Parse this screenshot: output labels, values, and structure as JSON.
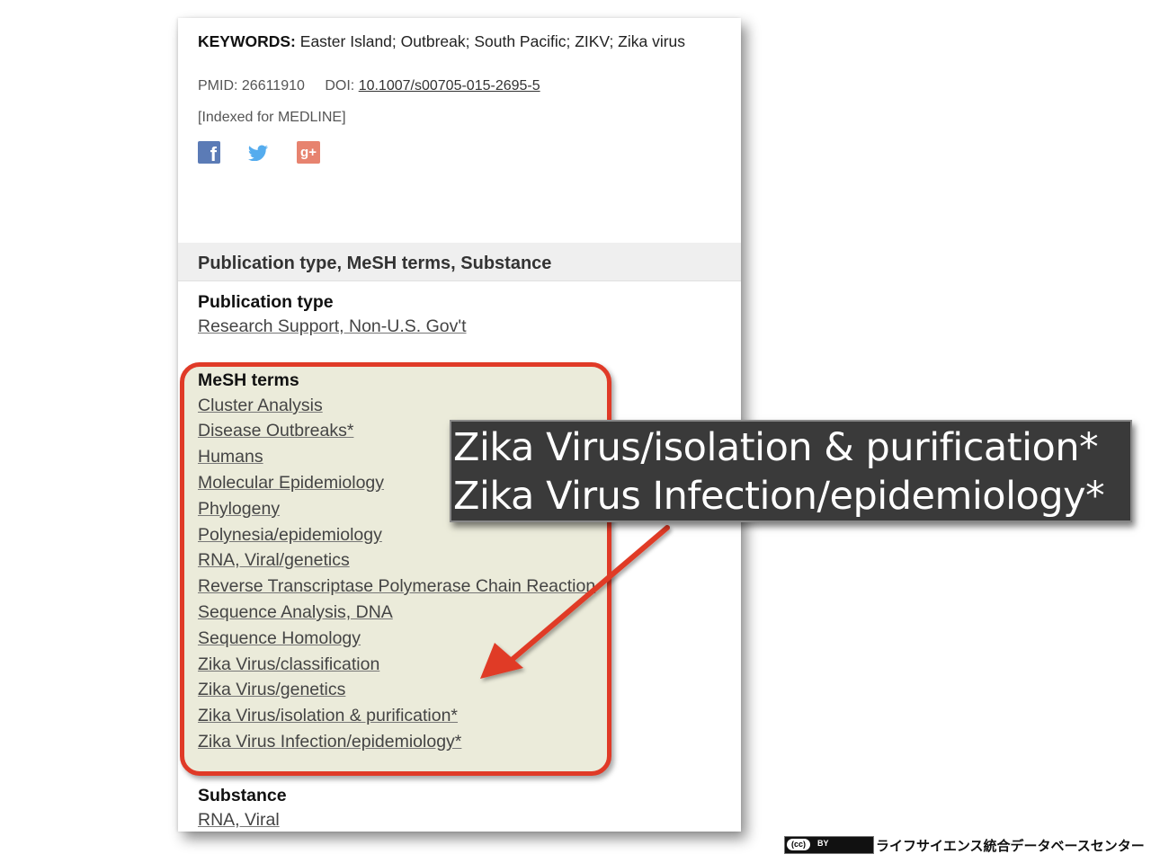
{
  "keywords": {
    "label": "KEYWORDS:",
    "value": "Easter Island; Outbreak; South Pacific; ZIKV; Zika virus"
  },
  "meta": {
    "pmid": "PMID: 26611910",
    "doi_label": "DOI:",
    "doi_link": "10.1007/s00705-015-2695-5",
    "indexed": "[Indexed for MEDLINE]"
  },
  "social": {
    "facebook_icon": "facebook-icon",
    "twitter_icon": "twitter-icon",
    "googleplus_icon": "google-plus-icon"
  },
  "section": {
    "title": "Publication type, MeSH terms, Substance"
  },
  "publication_type": {
    "heading": "Publication type",
    "items": [
      "Research Support, Non-U.S. Gov't"
    ]
  },
  "mesh": {
    "heading": "MeSH terms",
    "items": [
      "Cluster Analysis",
      "Disease Outbreaks*",
      "Humans",
      "Molecular Epidemiology",
      "Phylogeny",
      "Polynesia/epidemiology",
      "RNA, Viral/genetics",
      "Reverse Transcriptase Polymerase Chain Reaction",
      "Sequence Analysis, DNA",
      "Sequence Homology",
      "Zika Virus/classification",
      "Zika Virus/genetics",
      "Zika Virus/isolation & purification*",
      "Zika Virus Infection/epidemiology*"
    ],
    "highlight_color": "#e03a27"
  },
  "substance": {
    "heading": "Substance",
    "items": [
      "RNA, Viral"
    ]
  },
  "callout": {
    "line1": "Zika Virus/isolation & purification*",
    "line2": "Zika Virus Infection/epidemiology*"
  },
  "footer": {
    "license_left": "(cc)",
    "license_right": "BY",
    "org": "ライフサイエンス統合データベースセンター"
  }
}
